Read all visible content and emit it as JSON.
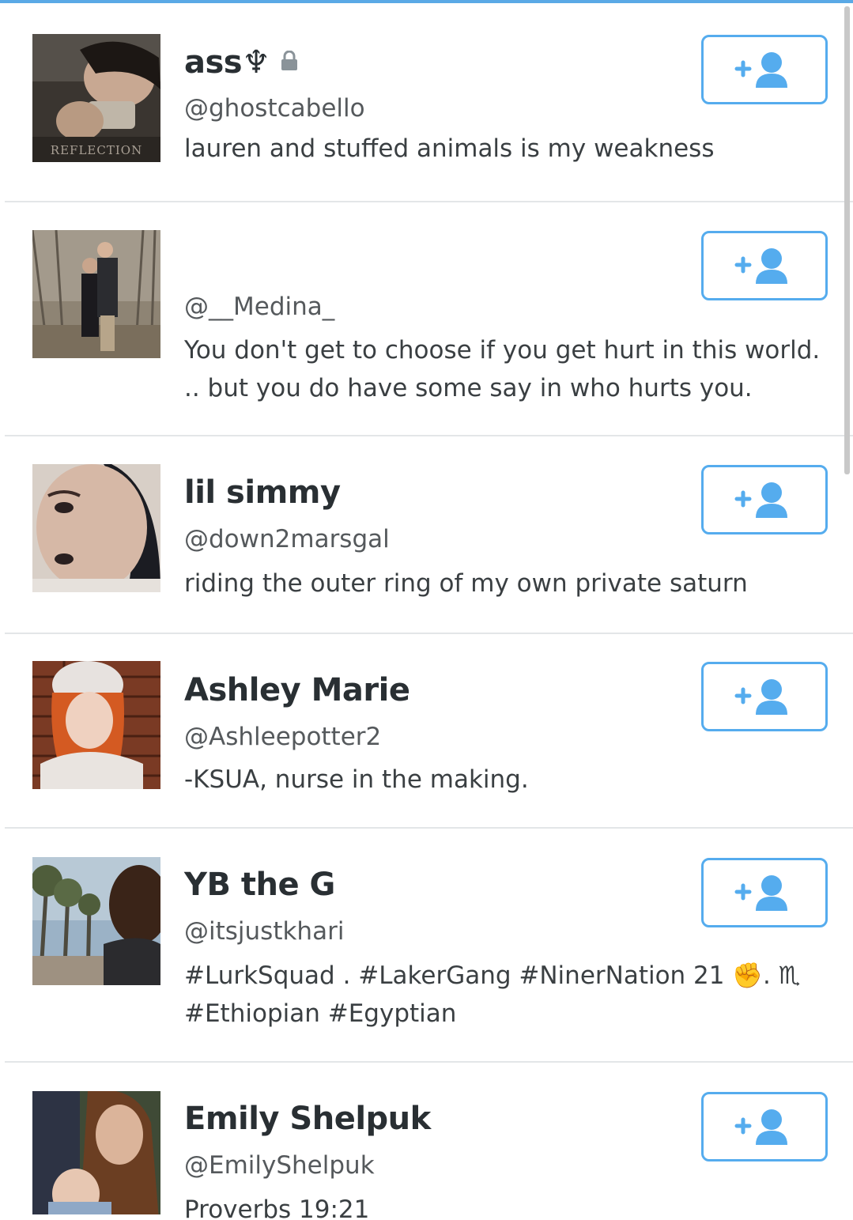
{
  "accent_color": "#55acee",
  "follow_icon": "follow-user-icon",
  "users": [
    {
      "name": "ass♆",
      "handle": "@ghostcabello",
      "bio": "lauren and stuffed animals is my weakness",
      "protected": true,
      "avatar_caption": "REFLECTION"
    },
    {
      "name": "",
      "handle": "@__Medina_",
      "bio": "You don't get to choose if you get hurt in this world. .. but you do have some say in who hurts you.",
      "protected": false
    },
    {
      "name": "lil simmy",
      "handle": "@down2marsgal",
      "bio": "riding the outer ring of my own private saturn",
      "protected": false
    },
    {
      "name": "Ashley Marie",
      "handle": "@Ashleepotter2",
      "bio": "-KSUA, nurse in the making.",
      "protected": false
    },
    {
      "name": "YB the G",
      "handle": "@itsjustkhari",
      "bio": "#LurkSquad . #LakerGang #NinerNation 21 ✊. ♏ #Ethiopian #Egyptian",
      "protected": false
    },
    {
      "name": "Emily Shelpuk",
      "handle": "@EmilyShelpuk",
      "bio": "Proverbs 19:21",
      "protected": false
    }
  ]
}
